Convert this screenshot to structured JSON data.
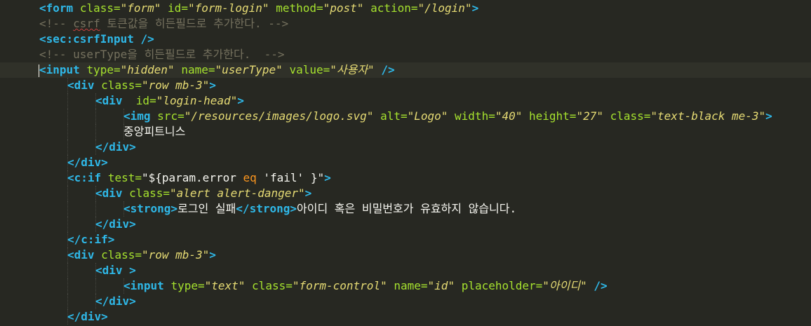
{
  "colors": {
    "background": "#272822",
    "tag": "#2fb8e8",
    "attribute": "#a6e22e",
    "string": "#e6db74",
    "comment": "#75715e",
    "keyword": "#fd971f",
    "text": "#f8f8f2"
  },
  "lines": [
    {
      "indent": 1,
      "current": false,
      "tokens": [
        {
          "t": "tag",
          "v": "<form"
        },
        {
          "t": "plain",
          "v": " "
        },
        {
          "t": "attr",
          "v": "class="
        },
        {
          "t": "str",
          "v": "\"form\""
        },
        {
          "t": "plain",
          "v": " "
        },
        {
          "t": "attr",
          "v": "id="
        },
        {
          "t": "str",
          "v": "\"form-login\""
        },
        {
          "t": "plain",
          "v": " "
        },
        {
          "t": "attr",
          "v": "method="
        },
        {
          "t": "str",
          "v": "\"post\""
        },
        {
          "t": "plain",
          "v": " "
        },
        {
          "t": "attr",
          "v": "action="
        },
        {
          "t": "str",
          "v": "\"/login\""
        },
        {
          "t": "tag",
          "v": ">"
        }
      ]
    },
    {
      "indent": 1,
      "current": false,
      "tokens": [
        {
          "t": "cmt",
          "v": "<!-- "
        },
        {
          "t": "cmt spell",
          "v": "csrf"
        },
        {
          "t": "cmt",
          "v": " 토큰값을 히든필드로 추가한다. -->"
        }
      ]
    },
    {
      "indent": 1,
      "current": false,
      "tokens": [
        {
          "t": "tag",
          "v": "<sec:csrfInput"
        },
        {
          "t": "plain",
          "v": " "
        },
        {
          "t": "tag",
          "v": "/>"
        }
      ]
    },
    {
      "indent": 1,
      "current": false,
      "tokens": [
        {
          "t": "cmt",
          "v": "<!-- userType을 히든필드로 추가한다.  -->"
        }
      ]
    },
    {
      "indent": 1,
      "current": true,
      "cursor": true,
      "tokens": [
        {
          "t": "tag",
          "v": "<input"
        },
        {
          "t": "plain",
          "v": " "
        },
        {
          "t": "attr",
          "v": "type="
        },
        {
          "t": "str",
          "v": "\"hidden\""
        },
        {
          "t": "plain",
          "v": " "
        },
        {
          "t": "attr",
          "v": "name="
        },
        {
          "t": "str",
          "v": "\"userType\""
        },
        {
          "t": "plain",
          "v": " "
        },
        {
          "t": "attr",
          "v": "value="
        },
        {
          "t": "str",
          "v": "\"사용자\""
        },
        {
          "t": "plain",
          "v": " "
        },
        {
          "t": "tag",
          "v": "/>"
        }
      ]
    },
    {
      "indent": 2,
      "current": false,
      "tokens": [
        {
          "t": "tag",
          "v": "<div"
        },
        {
          "t": "plain",
          "v": " "
        },
        {
          "t": "attr",
          "v": "class="
        },
        {
          "t": "str",
          "v": "\"row mb-3\""
        },
        {
          "t": "tag",
          "v": ">"
        }
      ]
    },
    {
      "indent": 3,
      "current": false,
      "tokens": [
        {
          "t": "tag",
          "v": "<div"
        },
        {
          "t": "plain",
          "v": "  "
        },
        {
          "t": "attr",
          "v": "id="
        },
        {
          "t": "str",
          "v": "\"login-head\""
        },
        {
          "t": "tag",
          "v": ">"
        }
      ]
    },
    {
      "indent": 4,
      "current": false,
      "tokens": [
        {
          "t": "tag",
          "v": "<img"
        },
        {
          "t": "plain",
          "v": " "
        },
        {
          "t": "attr",
          "v": "src="
        },
        {
          "t": "str",
          "v": "\"/resources/images/logo.svg\""
        },
        {
          "t": "plain",
          "v": " "
        },
        {
          "t": "attr",
          "v": "alt="
        },
        {
          "t": "str",
          "v": "\"Logo\""
        },
        {
          "t": "plain",
          "v": " "
        },
        {
          "t": "attr",
          "v": "width="
        },
        {
          "t": "str",
          "v": "\"40\""
        },
        {
          "t": "plain",
          "v": " "
        },
        {
          "t": "attr",
          "v": "height="
        },
        {
          "t": "str",
          "v": "\"27\""
        },
        {
          "t": "plain",
          "v": " "
        },
        {
          "t": "attr",
          "v": "class="
        },
        {
          "t": "str",
          "v": "\"text-black me-3\""
        },
        {
          "t": "tag",
          "v": ">"
        }
      ]
    },
    {
      "indent": 4,
      "current": false,
      "tokens": [
        {
          "t": "plain",
          "v": "중앙피트니스"
        }
      ]
    },
    {
      "indent": 3,
      "current": false,
      "tokens": [
        {
          "t": "tag",
          "v": "</div>"
        }
      ]
    },
    {
      "indent": 2,
      "current": false,
      "tokens": [
        {
          "t": "tag",
          "v": "</div>"
        }
      ]
    },
    {
      "indent": 2,
      "current": false,
      "tokens": [
        {
          "t": "tag",
          "v": "<c:if"
        },
        {
          "t": "plain",
          "v": " "
        },
        {
          "t": "attr",
          "v": "test="
        },
        {
          "t": "plain",
          "v": "\"${param.error "
        },
        {
          "t": "kw",
          "v": "eq"
        },
        {
          "t": "plain",
          "v": " 'fail' }\""
        },
        {
          "t": "tag",
          "v": ">"
        }
      ]
    },
    {
      "indent": 3,
      "current": false,
      "tokens": [
        {
          "t": "tag",
          "v": "<div"
        },
        {
          "t": "plain",
          "v": " "
        },
        {
          "t": "attr",
          "v": "class="
        },
        {
          "t": "str",
          "v": "\"alert alert-danger\""
        },
        {
          "t": "tag",
          "v": ">"
        }
      ]
    },
    {
      "indent": 4,
      "current": false,
      "tokens": [
        {
          "t": "tag",
          "v": "<strong>"
        },
        {
          "t": "plain",
          "v": "로그인 실패"
        },
        {
          "t": "tag",
          "v": "</strong>"
        },
        {
          "t": "plain",
          "v": "아이디 혹은 비밀번호가 유효하지 않습니다."
        }
      ]
    },
    {
      "indent": 3,
      "current": false,
      "tokens": [
        {
          "t": "tag",
          "v": "</div>"
        }
      ]
    },
    {
      "indent": 2,
      "current": false,
      "tokens": [
        {
          "t": "tag",
          "v": "</c:if>"
        }
      ]
    },
    {
      "indent": 2,
      "current": false,
      "tokens": [
        {
          "t": "tag",
          "v": "<div"
        },
        {
          "t": "plain",
          "v": " "
        },
        {
          "t": "attr",
          "v": "class="
        },
        {
          "t": "str",
          "v": "\"row mb-3\""
        },
        {
          "t": "tag",
          "v": ">"
        }
      ]
    },
    {
      "indent": 3,
      "current": false,
      "tokens": [
        {
          "t": "tag",
          "v": "<div"
        },
        {
          "t": "plain",
          "v": " "
        },
        {
          "t": "tag",
          "v": ">"
        }
      ]
    },
    {
      "indent": 4,
      "current": false,
      "tokens": [
        {
          "t": "tag",
          "v": "<input"
        },
        {
          "t": "plain",
          "v": " "
        },
        {
          "t": "attr",
          "v": "type="
        },
        {
          "t": "str",
          "v": "\"text\""
        },
        {
          "t": "plain",
          "v": " "
        },
        {
          "t": "attr",
          "v": "class="
        },
        {
          "t": "str",
          "v": "\"form-control\""
        },
        {
          "t": "plain",
          "v": " "
        },
        {
          "t": "attr",
          "v": "name="
        },
        {
          "t": "str",
          "v": "\"id\""
        },
        {
          "t": "plain",
          "v": " "
        },
        {
          "t": "attr",
          "v": "placeholder="
        },
        {
          "t": "str",
          "v": "\"아이디\""
        },
        {
          "t": "plain",
          "v": " "
        },
        {
          "t": "tag",
          "v": "/>"
        }
      ]
    },
    {
      "indent": 3,
      "current": false,
      "tokens": [
        {
          "t": "tag",
          "v": "</div>"
        }
      ]
    },
    {
      "indent": 2,
      "current": false,
      "tokens": [
        {
          "t": "tag",
          "v": "</div>"
        }
      ]
    }
  ]
}
